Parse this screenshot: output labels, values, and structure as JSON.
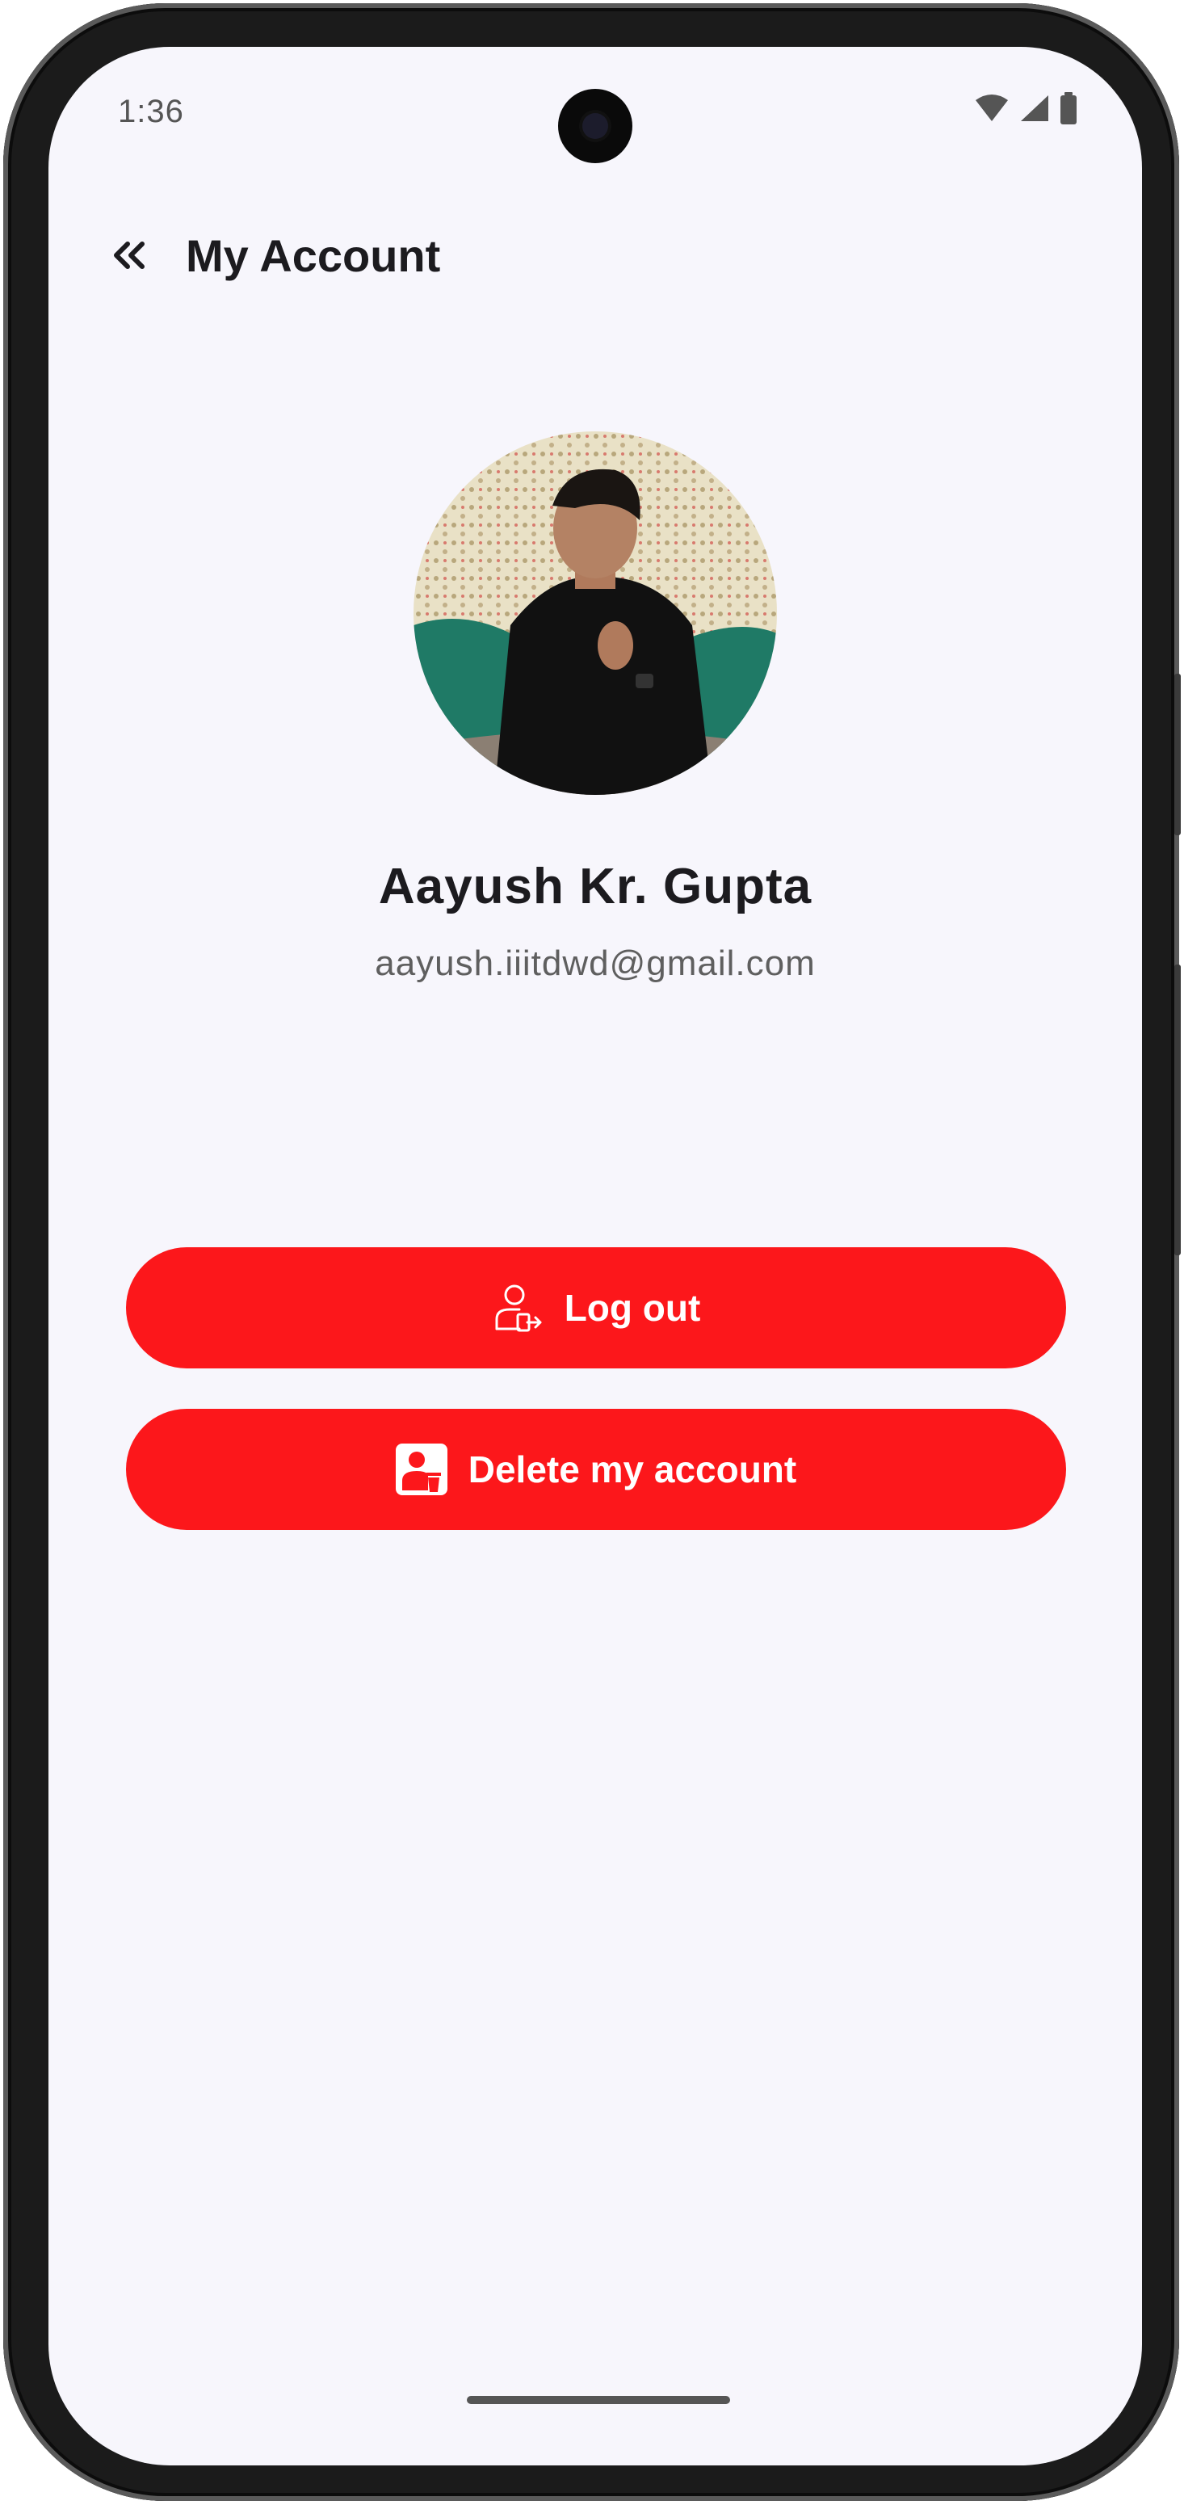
{
  "status_bar": {
    "time": "1:36",
    "icons": [
      "wifi-icon",
      "cell-signal-icon",
      "battery-icon"
    ]
  },
  "header": {
    "back_icon": "double-chevron-left-icon",
    "title": "My Account"
  },
  "profile": {
    "name": "Aayush Kr. Gupta",
    "email": "aayush.iiitdwd@gmail.com"
  },
  "actions": {
    "logout": {
      "label": "Log out",
      "icon": "user-logout-icon"
    },
    "delete": {
      "label": "Delete my account",
      "icon": "delete-account-icon"
    }
  },
  "colors": {
    "accent": "#fc171b",
    "background": "#f7f6fc",
    "title_text": "#1c1b1f",
    "secondary_text": "#5f5f5f"
  }
}
